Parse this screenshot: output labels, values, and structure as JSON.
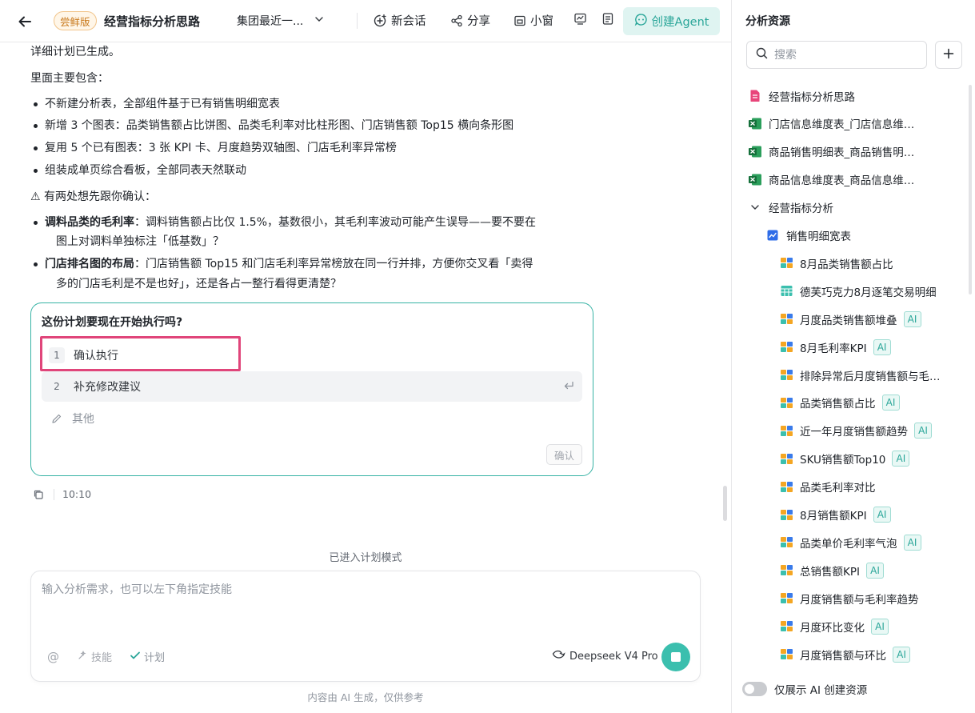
{
  "topbar": {
    "badge": "尝鲜版",
    "title": "经营指标分析思路",
    "dataset_select": "集团最近一...",
    "new_chat": "新会话",
    "share": "分享",
    "small_window": "小窗",
    "create_agent": "创建Agent"
  },
  "message": {
    "line1": "详细计划已生成。",
    "line2": "里面主要包含：",
    "bullets": [
      "不新建分析表，全部组件基于已有销售明细宽表",
      "新增 3 个图表：品类销售额占比饼图、品类毛利率对比柱形图、门店销售额 Top15 横向条形图",
      "复用 5 个已有图表：3 张 KPI 卡、月度趋势双轴图、门店毛利率异常榜",
      "组装成单页综合看板，全部同表天然联动"
    ],
    "confirm_intro": "⚠ 有两处想先跟你确认：",
    "questions": [
      {
        "bold": "调料品类的毛利率",
        "text1": "：调料销售额占比仅 1.5%，基数很小，其毛利率波动可能产生误导——要不要在",
        "text2": "图上对调料单独标注「低基数」？"
      },
      {
        "bold": "门店排名图的布局",
        "text1": "：门店销售额 Top15 和门店毛利率异常榜放在同一行并排，方便你交叉看「卖得",
        "text2": "多的门店毛利是不是也好」，还是各占一整行看得更清楚？"
      }
    ]
  },
  "plan_card": {
    "question": "这份计划要现在开始执行吗?",
    "options": [
      {
        "num": "1",
        "label": "确认执行"
      },
      {
        "num": "2",
        "label": "补充修改建议"
      }
    ],
    "other_label": "其他",
    "confirm_button": "确认"
  },
  "meta": {
    "time": "10:10"
  },
  "plan_mode_text": "已进入计划模式",
  "input": {
    "placeholder": "输入分析需求，也可以左下角指定技能",
    "skill_label": "技能",
    "plan_label": "计划",
    "model_name": "Deepseek V4 Pro"
  },
  "disclaimer": "内容由 AI 生成，仅供参考",
  "sidebar": {
    "title": "分析资源",
    "search_placeholder": "搜索",
    "items": [
      {
        "label": "经营指标分析思路",
        "icon": "doc-icon",
        "ai": ""
      },
      {
        "label": "门店信息维度表_门店信息维度表",
        "icon": "excel-icon",
        "ai": ""
      },
      {
        "label": "商品销售明细表_商品销售明细表",
        "icon": "excel-icon",
        "ai": ""
      },
      {
        "label": "商品信息维度表_商品信息维度表",
        "icon": "excel-icon",
        "ai": ""
      },
      {
        "label": "经营指标分析",
        "icon": "chevron-down-icon",
        "ai": ""
      },
      {
        "label": "销售明细宽表",
        "icon": "dataset-icon",
        "ai": ""
      },
      {
        "label": "8月品类销售额占比",
        "icon": "chart-icon",
        "ai": ""
      },
      {
        "label": "德芙巧克力8月逐笔交易明细",
        "icon": "table-icon",
        "ai": ""
      },
      {
        "label": "月度品类销售额堆叠",
        "icon": "chart-icon",
        "ai": "AI"
      },
      {
        "label": "8月毛利率KPI",
        "icon": "chart-icon",
        "ai": "AI"
      },
      {
        "label": "排除异常后月度销售额与毛利率",
        "icon": "chart-icon",
        "ai": ""
      },
      {
        "label": "品类销售额占比",
        "icon": "chart-icon",
        "ai": "AI"
      },
      {
        "label": "近一年月度销售额趋势",
        "icon": "chart-icon",
        "ai": "AI"
      },
      {
        "label": "SKU销售额Top10",
        "icon": "chart-icon",
        "ai": "AI"
      },
      {
        "label": "品类毛利率对比",
        "icon": "chart-icon",
        "ai": ""
      },
      {
        "label": "8月销售额KPI",
        "icon": "chart-icon",
        "ai": "AI"
      },
      {
        "label": "品类单价毛利率气泡",
        "icon": "chart-icon",
        "ai": "AI"
      },
      {
        "label": "总销售额KPI",
        "icon": "chart-icon",
        "ai": "AI"
      },
      {
        "label": "月度销售额与毛利率趋势",
        "icon": "chart-icon",
        "ai": ""
      },
      {
        "label": "月度环比变化",
        "icon": "chart-icon",
        "ai": "AI"
      },
      {
        "label": "月度销售额与环比",
        "icon": "chart-icon",
        "ai": "AI"
      }
    ],
    "footer_toggle_label": "仅展示 AI 创建资源"
  },
  "colors": {
    "accent": "#3bbfae",
    "accent_text": "#2aa699",
    "highlight_border": "#e0457a",
    "badge_bg": "#fff6e8"
  }
}
